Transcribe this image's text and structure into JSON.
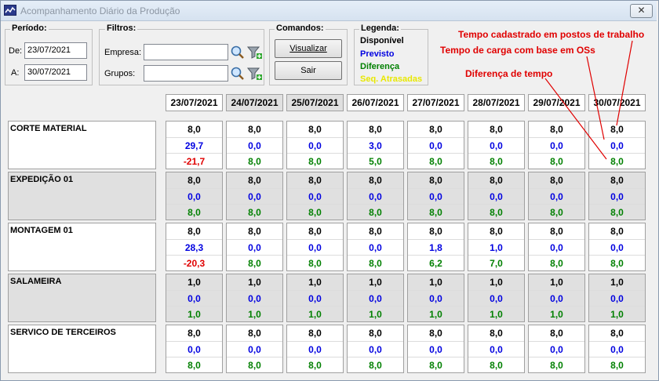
{
  "window": {
    "title": "Acompanhamento Diário da Produção",
    "close_symbol": "✕"
  },
  "periodo": {
    "title": "Período:",
    "de_label": "De:",
    "de_value": "23/07/2021",
    "a_label": "A:",
    "a_value": "30/07/2021"
  },
  "filtros": {
    "title": "Filtros:",
    "empresa_label": "Empresa:",
    "empresa_value": "",
    "grupos_label": "Grupos:",
    "grupos_value": ""
  },
  "comandos": {
    "title": "Comandos:",
    "visualizar": "Visualizar",
    "sair": "Sair"
  },
  "legenda": {
    "title": "Legenda:",
    "items": [
      {
        "label": "Disponível",
        "color": "#000000"
      },
      {
        "label": "Previsto",
        "color": "#0000e0"
      },
      {
        "label": "Diferença",
        "color": "#008000"
      },
      {
        "label": "Seq. Atrasadas",
        "color": "#e8e800"
      }
    ]
  },
  "annotations": {
    "tempo_cadastrado": "Tempo cadastrado em postos de trabalho",
    "tempo_carga": "Tempo de carga com base em OSs",
    "diferenca": "Diferença de tempo",
    "color": "#e00000"
  },
  "dates": [
    "23/07/2021",
    "24/07/2021",
    "25/07/2021",
    "26/07/2021",
    "27/07/2021",
    "28/07/2021",
    "29/07/2021",
    "30/07/2021"
  ],
  "rows": [
    {
      "name": "CORTE MATERIAL",
      "disponivel": [
        "8,0",
        "8,0",
        "8,0",
        "8,0",
        "8,0",
        "8,0",
        "8,0",
        "8,0"
      ],
      "previsto": [
        "29,7",
        "0,0",
        "0,0",
        "3,0",
        "0,0",
        "0,0",
        "0,0",
        "0,0"
      ],
      "diferenca": [
        "-21,7",
        "8,0",
        "8,0",
        "5,0",
        "8,0",
        "8,0",
        "8,0",
        "8,0"
      ]
    },
    {
      "name": "EXPEDIÇÃO 01",
      "disponivel": [
        "8,0",
        "8,0",
        "8,0",
        "8,0",
        "8,0",
        "8,0",
        "8,0",
        "8,0"
      ],
      "previsto": [
        "0,0",
        "0,0",
        "0,0",
        "0,0",
        "0,0",
        "0,0",
        "0,0",
        "0,0"
      ],
      "diferenca": [
        "8,0",
        "8,0",
        "8,0",
        "8,0",
        "8,0",
        "8,0",
        "8,0",
        "8,0"
      ]
    },
    {
      "name": "MONTAGEM 01",
      "disponivel": [
        "8,0",
        "8,0",
        "8,0",
        "8,0",
        "8,0",
        "8,0",
        "8,0",
        "8,0"
      ],
      "previsto": [
        "28,3",
        "0,0",
        "0,0",
        "0,0",
        "1,8",
        "1,0",
        "0,0",
        "0,0"
      ],
      "diferenca": [
        "-20,3",
        "8,0",
        "8,0",
        "8,0",
        "6,2",
        "7,0",
        "8,0",
        "8,0"
      ]
    },
    {
      "name": "SALAMEIRA",
      "disponivel": [
        "1,0",
        "1,0",
        "1,0",
        "1,0",
        "1,0",
        "1,0",
        "1,0",
        "1,0"
      ],
      "previsto": [
        "0,0",
        "0,0",
        "0,0",
        "0,0",
        "0,0",
        "0,0",
        "0,0",
        "0,0"
      ],
      "diferenca": [
        "1,0",
        "1,0",
        "1,0",
        "1,0",
        "1,0",
        "1,0",
        "1,0",
        "1,0"
      ]
    },
    {
      "name": "SERVICO DE TERCEIROS",
      "disponivel": [
        "8,0",
        "8,0",
        "8,0",
        "8,0",
        "8,0",
        "8,0",
        "8,0",
        "8,0"
      ],
      "previsto": [
        "0,0",
        "0,0",
        "0,0",
        "0,0",
        "0,0",
        "0,0",
        "0,0",
        "0,0"
      ],
      "diferenca": [
        "8,0",
        "8,0",
        "8,0",
        "8,0",
        "8,0",
        "8,0",
        "8,0",
        "8,0"
      ]
    }
  ]
}
